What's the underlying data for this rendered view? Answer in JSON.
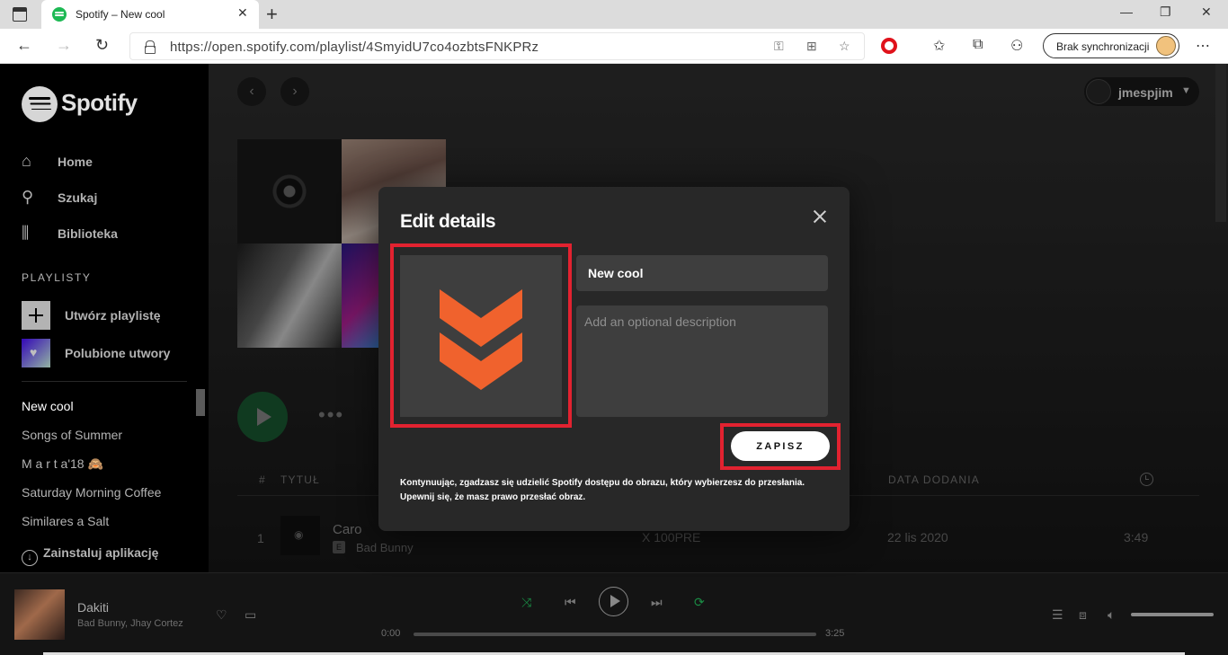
{
  "browser": {
    "tab_title": "Spotify – New cool",
    "url": "https://open.spotify.com/playlist/4SmyidU7co4ozbtsFNKPRz",
    "sync_label": "Brak synchronizacji"
  },
  "sidebar": {
    "logo": "Spotify",
    "nav": [
      {
        "label": "Home"
      },
      {
        "label": "Szukaj"
      },
      {
        "label": "Biblioteka"
      }
    ],
    "section_title": "PLAYLISTY",
    "create_playlist": "Utwórz playlistę",
    "liked_songs": "Polubione utwory",
    "playlists": [
      "New cool",
      "Songs of Summer",
      "M a r t a'18 🙈",
      "Saturday Morning Coffee",
      "Similares a Salt"
    ],
    "install_app": "Zainstaluj aplikację"
  },
  "header": {
    "username": "jmespjim"
  },
  "tracklist": {
    "columns": {
      "num": "#",
      "title": "TYTUŁ",
      "date": "DATA DODANIA"
    },
    "rows": [
      {
        "num": "1",
        "title": "Caro",
        "explicit": "E",
        "artist": "Bad Bunny",
        "album": "X 100PRE",
        "date": "22 lis 2020",
        "duration": "3:49"
      }
    ]
  },
  "player": {
    "title": "Dakiti",
    "artist": "Bad Bunny, Jhay Cortez",
    "elapsed": "0:00",
    "total": "3:25"
  },
  "modal": {
    "title": "Edit details",
    "name_value": "New cool",
    "description_placeholder": "Add an optional description",
    "save_label": "ZAPISZ",
    "disclaimer": "Kontynuując, zgadzasz się udzielić Spotify dostępu do obrazu, który wybierzesz do przesłania. Upewnij się, że masz prawo przesłać obraz.",
    "highlight_color": "#e22230",
    "image_accent": "#f0622d"
  }
}
